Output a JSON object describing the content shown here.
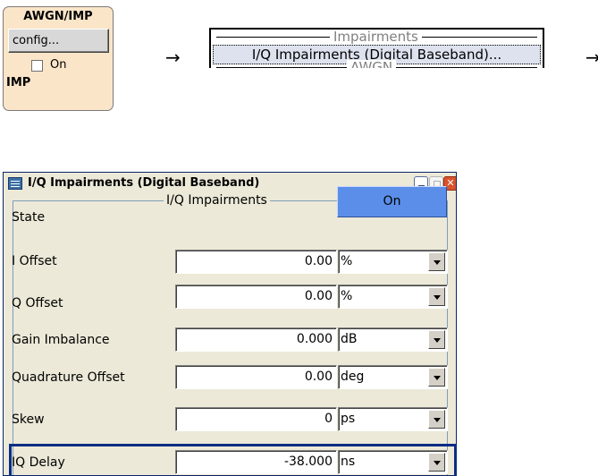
{
  "block": {
    "title": "AWGN/IMP",
    "config_label": "config...",
    "on_label": "On",
    "on_checked": false,
    "bottom_label": "IMP",
    "background": "#fbe5c8"
  },
  "arrows": {
    "symbol": "→"
  },
  "menu": {
    "separator_top": "Impairments",
    "item": "I/Q Impairments (Digital Baseband)...",
    "separator_bottom": "AWGN"
  },
  "dialog": {
    "title": "I/Q Impairments (Digital Baseband)",
    "group_label": "I/Q Impairments",
    "state": {
      "label": "State",
      "value": "On",
      "color": "#5b8ee8"
    },
    "rows": [
      {
        "label": "I Offset",
        "value": "0.00",
        "unit": "%"
      },
      {
        "label": "Q Offset",
        "value": "0.00",
        "unit": "%"
      },
      {
        "label": "Gain Imbalance",
        "value": "0.000",
        "unit": "dB"
      },
      {
        "label": "Quadrature Offset",
        "value": "0.00",
        "unit": "deg"
      },
      {
        "label": "Skew",
        "value": "0",
        "unit": "ps"
      },
      {
        "label": "IQ Delay",
        "value": "-38.000",
        "unit": "ns"
      }
    ],
    "focus_color": "#0c2c84"
  }
}
